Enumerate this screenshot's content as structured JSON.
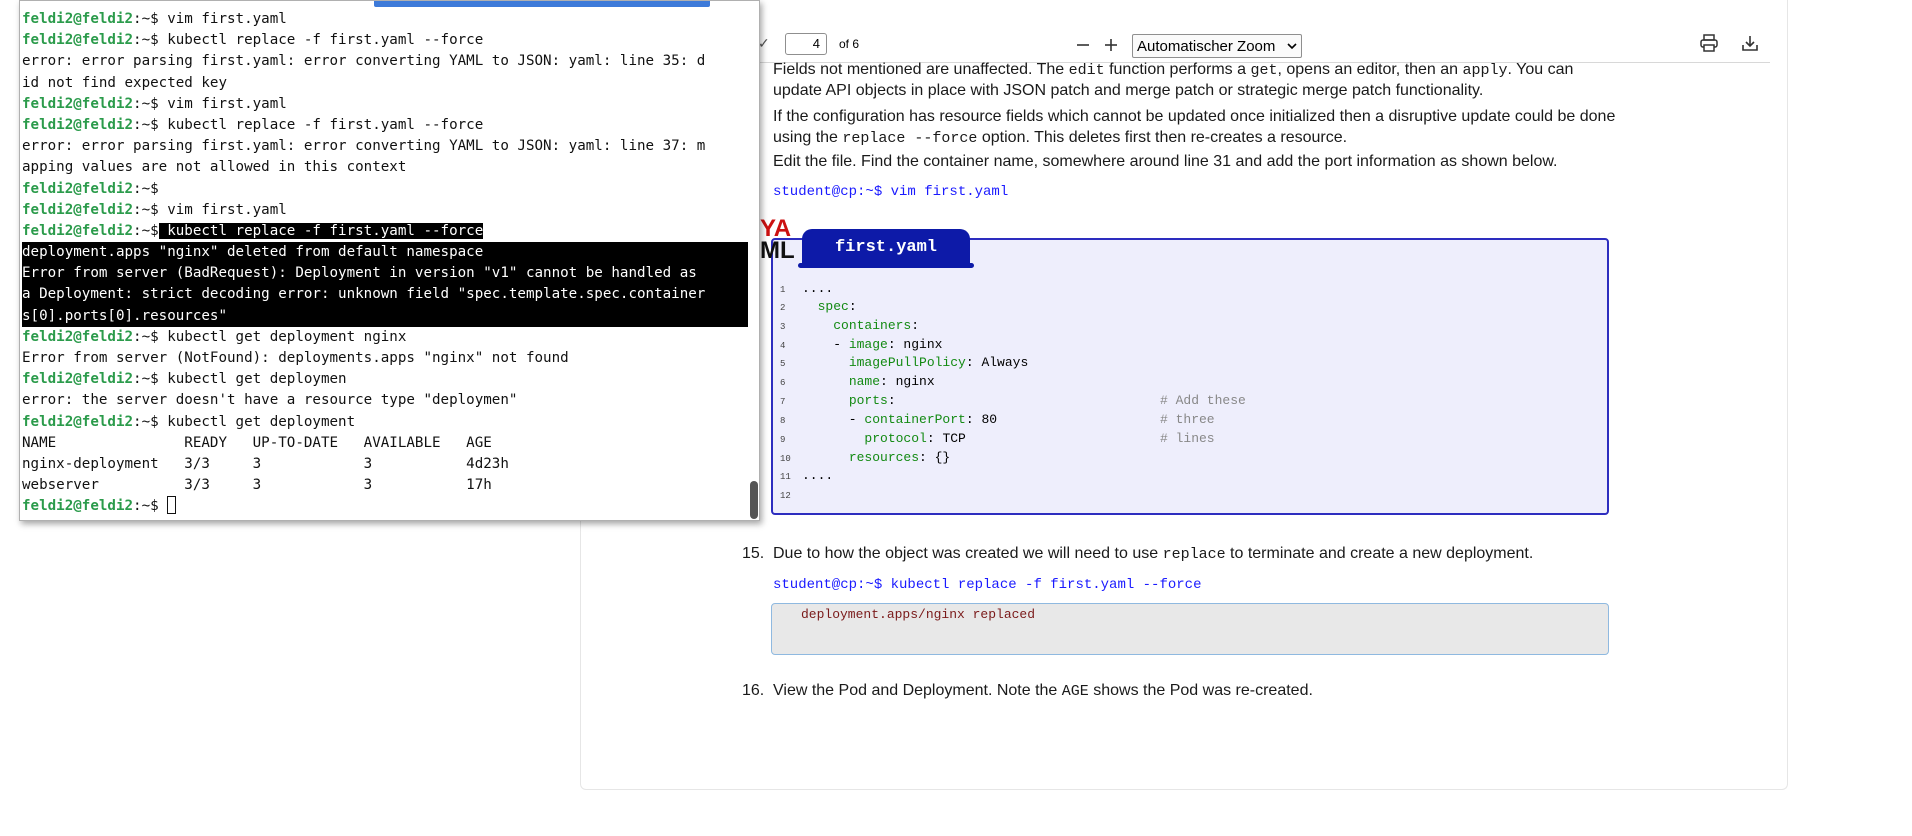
{
  "terminal": {
    "prompt_user": "feldi2@feldi2",
    "prompt_path": ":~$",
    "lines": [
      {
        "type": "cmd",
        "text": " vim first.yaml"
      },
      {
        "type": "cmd",
        "text": " kubectl replace -f first.yaml --force"
      },
      {
        "type": "out",
        "text": "error: error parsing first.yaml: error converting YAML to JSON: yaml: line 35: d"
      },
      {
        "type": "out",
        "text": "id not find expected key"
      },
      {
        "type": "cmd",
        "text": " vim first.yaml"
      },
      {
        "type": "cmd",
        "text": " kubectl replace -f first.yaml --force"
      },
      {
        "type": "out",
        "text": "error: error parsing first.yaml: error converting YAML to JSON: yaml: line 37: m"
      },
      {
        "type": "out",
        "text": "apping values are not allowed in this context"
      },
      {
        "type": "cmd",
        "text": ""
      },
      {
        "type": "cmd",
        "text": " vim first.yaml"
      },
      {
        "type": "cmdsel",
        "text": " kubectl replace -f first.yaml --force"
      },
      {
        "type": "sel",
        "text": "deployment.apps \"nginx\" deleted from default namespace"
      },
      {
        "type": "sel",
        "text": "Error from server (BadRequest): Deployment in version \"v1\" cannot be handled as"
      },
      {
        "type": "sel",
        "text": "a Deployment: strict decoding error: unknown field \"spec.template.spec.container"
      },
      {
        "type": "sel",
        "text": "s[0].ports[0].resources\""
      },
      {
        "type": "cmd",
        "text": " kubectl get deployment nginx"
      },
      {
        "type": "out",
        "text": "Error from server (NotFound): deployments.apps \"nginx\" not found"
      },
      {
        "type": "cmd",
        "text": " kubectl get deploymen"
      },
      {
        "type": "out",
        "text": "error: the server doesn't have a resource type \"deploymen\""
      },
      {
        "type": "cmd",
        "text": " kubectl get deployment"
      },
      {
        "type": "out",
        "text": "NAME               READY   UP-TO-DATE   AVAILABLE   AGE"
      },
      {
        "type": "out",
        "text": "nginx-deployment   3/3     3            3           4d23h"
      },
      {
        "type": "out",
        "text": "webserver          3/3     3            3           17h"
      },
      {
        "type": "cursor",
        "text": " "
      }
    ]
  },
  "pdf_toolbar": {
    "page_value": "4",
    "page_total": "of 6",
    "zoom_label": "Automatischer Zoom"
  },
  "doc": {
    "p1a_pre": "Fields not mentioned are unaffected.  The ",
    "p1a_code1": "edit",
    "p1a_mid": " function performs a ",
    "p1a_code2": "get",
    "p1a_mid2": ", opens an editor, then an ",
    "p1a_code3": "apply",
    "p1a_end": ".  You can",
    "p1b": "update API objects in place with JSON patch and merge patch or strategic merge patch functionality.",
    "p2a": "If the configuration has resource fields which cannot be updated once initialized then a disruptive update could be done",
    "p2b_pre": "using the ",
    "p2b_code": "replace --force",
    "p2b_end": " option. This deletes first then re-creates a resource.",
    "p3": "Edit the file. Find the container name, somewhere around line 31 and add the port information as shown below.",
    "prompt1": "student@cp:~$ vim first.yaml",
    "code_title": "first.yaml",
    "logo_top": "YA",
    "logo_bottom": "ML",
    "code_lines": [
      {
        "n": "1",
        "t": "...."
      },
      {
        "n": "2",
        "t": "  spec:"
      },
      {
        "n": "3",
        "t": "    containers:"
      },
      {
        "n": "4",
        "t": "    - image: nginx"
      },
      {
        "n": "5",
        "t": "      imagePullPolicy: Always"
      },
      {
        "n": "6",
        "t": "      name: nginx"
      },
      {
        "n": "7",
        "t": "      ports:",
        "c": "# Add these"
      },
      {
        "n": "8",
        "t": "      - containerPort: 80",
        "c": "# three"
      },
      {
        "n": "9",
        "t": "        protocol: TCP",
        "c": "# lines"
      },
      {
        "n": "10",
        "t": "      resources: {}"
      },
      {
        "n": "11",
        "t": "...."
      },
      {
        "n": "12",
        "t": ""
      }
    ],
    "step15_num": "15.",
    "step15_pre": "Due to how the object was created we will need to use ",
    "step15_code": "replace",
    "step15_end": " to terminate and create a new deployment.",
    "prompt2": "student@cp:~$ kubectl replace -f first.yaml --force",
    "output2": "deployment.apps/nginx replaced",
    "step16_num": "16.",
    "step16_pre": "View the Pod and Deployment. Note the ",
    "step16_code": "AGE",
    "step16_end": " shows the Pod was re-created."
  }
}
